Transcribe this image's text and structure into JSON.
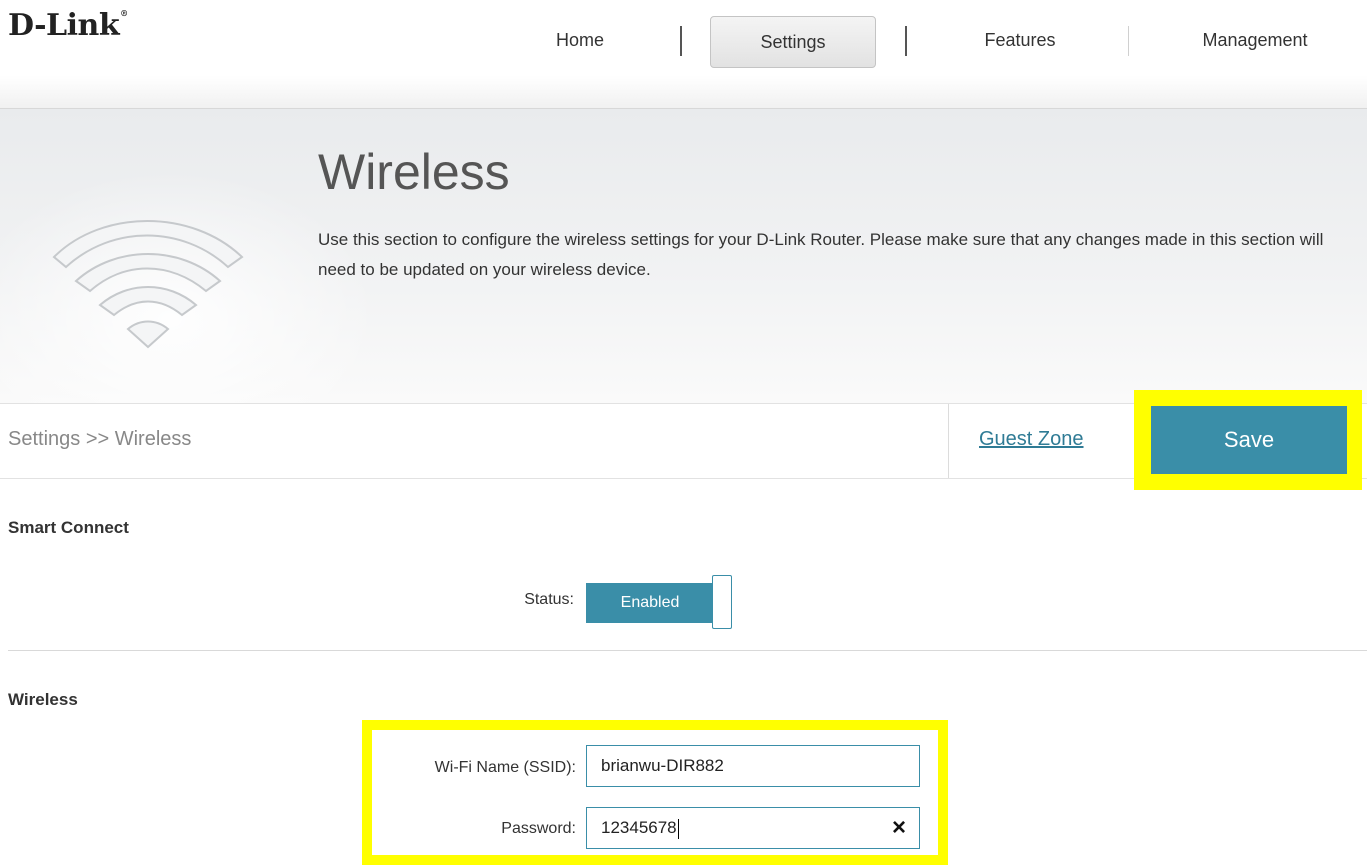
{
  "brand": {
    "logo_text": "D-Link",
    "logo_mark": "®"
  },
  "nav": {
    "home": "Home",
    "settings": "Settings",
    "features": "Features",
    "management": "Management",
    "active": "Settings"
  },
  "banner": {
    "title": "Wireless",
    "description": "Use this section to configure the wireless settings for your D-Link Router. Please make sure that any changes made in this section will need to be updated on your wireless device.",
    "icon": "wifi-icon"
  },
  "breadcrumb": "Settings >> Wireless",
  "actions": {
    "guest_zone": "Guest Zone",
    "save": "Save"
  },
  "smart_connect": {
    "title": "Smart Connect",
    "status_label": "Status:",
    "status_value": "Enabled"
  },
  "wireless": {
    "title": "Wireless",
    "ssid_label": "Wi-Fi Name (SSID):",
    "ssid_value": "brianwu-DIR882",
    "password_label": "Password:",
    "password_value": "12345678",
    "clear_icon": "×"
  },
  "colors": {
    "accent": "#3a8ea8",
    "link": "#2f7b95",
    "highlight": "#ffff00"
  }
}
